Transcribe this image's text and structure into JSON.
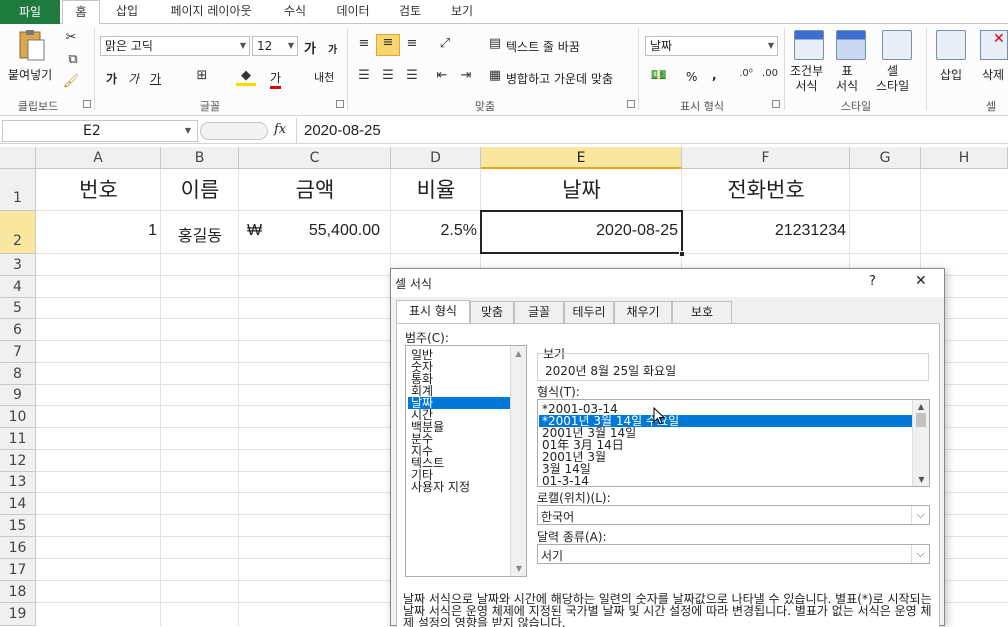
{
  "tabs": {
    "file": "파일",
    "items": [
      "홈",
      "삽입",
      "페이지 레이아웃",
      "수식",
      "데이터",
      "검토",
      "보기"
    ]
  },
  "ribbon": {
    "clipboard": {
      "paste": "붙여넣기",
      "label": "클립보드"
    },
    "font": {
      "name": "맑은 고딕",
      "size": "12",
      "bold": "가",
      "italic": "가",
      "underline": "가",
      "grow": "가",
      "shrink": "가",
      "color_glyph": "가",
      "phonetic": "내천",
      "label": "글꼴"
    },
    "align": {
      "wrap": "텍스트 줄 바꿈",
      "merge": "병합하고 가운데 맞춤",
      "label": "맞춤"
    },
    "number": {
      "format": "날짜",
      "percent": "%",
      "comma": ",",
      "label": "표시 형식"
    },
    "styles": {
      "conditional": "조건부\n서식",
      "table": "표\n서식",
      "cell": "셀\n스타일",
      "label": "스타일"
    },
    "cells": {
      "insert": "삽입",
      "delete": "삭제",
      "label": "셀"
    }
  },
  "formula_bar": {
    "name_box": "E2",
    "fx": "fx",
    "value": "2020-08-25"
  },
  "columns": [
    "A",
    "B",
    "C",
    "D",
    "E",
    "F",
    "G",
    "H"
  ],
  "rows": [
    "1",
    "2",
    "3",
    "4",
    "5",
    "6",
    "7",
    "8",
    "9",
    "10",
    "11",
    "12",
    "13",
    "14",
    "15",
    "16",
    "17",
    "18",
    "19"
  ],
  "cells": {
    "A1": "번호",
    "B1": "이름",
    "C1": "금액",
    "D1": "비율",
    "E1": "날짜",
    "F1": "전화번호",
    "A2": "1",
    "B2": "홍길동",
    "C2_symbol": "₩",
    "C2": "55,400.00",
    "D2": "2.5%",
    "E2": "2020-08-25",
    "F2": "21231234"
  },
  "dialog": {
    "title": "셀 서식",
    "help": "?",
    "close": "✕",
    "tabs": [
      "표시 형식",
      "맞춤",
      "글꼴",
      "테두리",
      "채우기",
      "보호"
    ],
    "category_label": "범주(C):",
    "categories": [
      "일반",
      "숫자",
      "통화",
      "회계",
      "날짜",
      "시간",
      "백분율",
      "분수",
      "지수",
      "텍스트",
      "기타",
      "사용자 지정"
    ],
    "selected_category": "날짜",
    "sample_label": "보기",
    "sample_value": "2020년 8월 25일 화요일",
    "type_label": "형식(T):",
    "types": [
      "*2001-03-14",
      "*2001년 3월 14일 수요일",
      "2001년 3월 14일",
      "01年 3月 14日",
      "2001년 3월",
      "3월 14일",
      "01-3-14"
    ],
    "selected_type": "*2001년 3월 14일 수요일",
    "locale_label": "로캘(위치)(L):",
    "locale_value": "한국어",
    "calendar_label": "달력 종류(A):",
    "calendar_value": "서기",
    "description": "날짜 서식으로 날짜와 시간에 해당하는 일련의 숫자를 날짜값으로 나타낼 수 있습니다. 별표(*)로 시작되는 날짜 서식은 운영 체제에 지정된 국가별 날짜 및 시간 설정에 따라 변경됩니다. 별표가 없는 서식은 운영 체제 설정의 영향을 받지 않습니다."
  }
}
